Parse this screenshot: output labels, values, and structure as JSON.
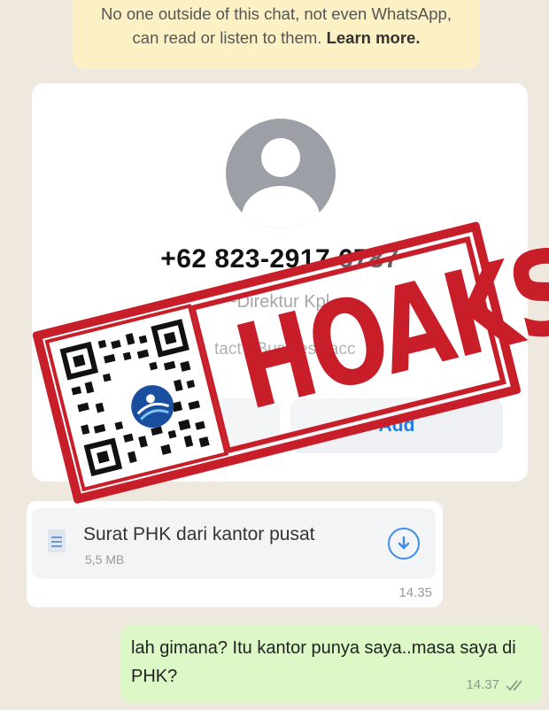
{
  "encryption_notice": {
    "line1": "No one outside of this chat, not even WhatsApp,",
    "line2": "can read or listen to them.",
    "link": "Learn more."
  },
  "contact_card": {
    "phone": "+62 823-2917 6787",
    "subname": "~Direktur Kpl",
    "info_text": "tact · Business acc",
    "add_button": "Add"
  },
  "incoming_message": {
    "file_name": "Surat PHK dari kantor pusat",
    "file_size": "5,5 MB",
    "time": "14.35"
  },
  "outgoing_message": {
    "text": "lah gimana? Itu kantor punya saya..masa saya di PHK?",
    "time": "14.37"
  },
  "stamp": {
    "text": "HOAKS",
    "color": "#c81e2a"
  },
  "colors": {
    "chat_bg": "#efe8df",
    "notice_bg": "#fbf1c4",
    "outgoing_bg": "#dcf8c6",
    "link_blue": "#1f7de6"
  }
}
